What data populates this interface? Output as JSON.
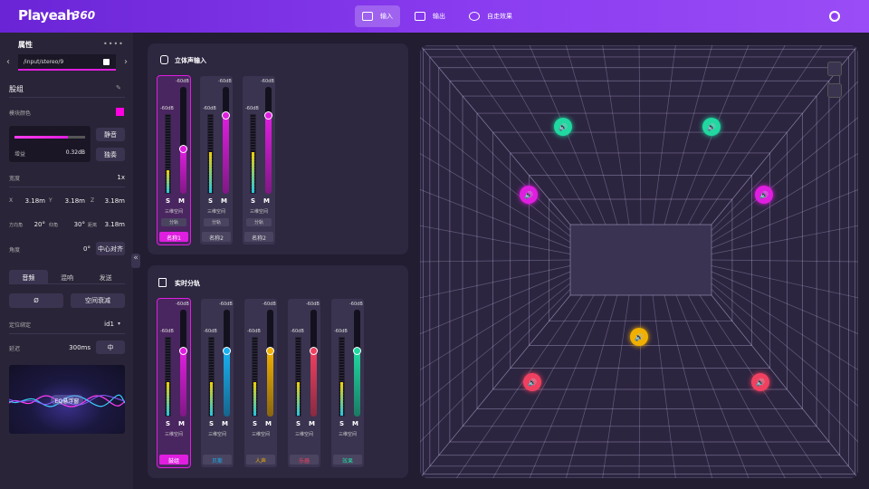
{
  "app": {
    "logo": "Playeah",
    "logo_suffix": "360"
  },
  "nav": [
    {
      "label": "输入",
      "active": true
    },
    {
      "label": "输出",
      "active": false
    },
    {
      "label": "自走效果",
      "active": false
    }
  ],
  "sidebar": {
    "title": "属性",
    "path": "/input/stereo/9",
    "group": "股组",
    "color_label": "模块颜色",
    "accent": "#ff00e0",
    "gain_label": "增益",
    "gain_value": "0.32dB",
    "gain_level": 0.75,
    "mute": "静音",
    "solo": "独奏",
    "width_label": "宽度",
    "width_value": "1x",
    "x_label": "X",
    "x_value": "3.18m",
    "y_label": "Y",
    "y_value": "3.18m",
    "z_label": "Z",
    "z_value": "3.18m",
    "azimuth_label": "方向角",
    "azimuth_value": "20°",
    "elevation_label": "仰角",
    "elevation_value": "30°",
    "distance_label": "距离",
    "distance_value": "3.18m",
    "angle_label": "角度",
    "angle_value": "0°",
    "center_btn": "中心对齐",
    "tabs": [
      "音频",
      "混响",
      "发送"
    ],
    "phase_btn": "Ø",
    "spatial_btn": "空间衰减",
    "pos_label": "定位绑定",
    "pos_value": "id1",
    "delay_label": "延迟",
    "delay_value": "300ms",
    "delay_btn": "中",
    "eq_label": "EQ悬浮窗"
  },
  "stereo": {
    "title": "立体声输入",
    "strips": [
      {
        "name": "名称1",
        "top_db": "-60dB",
        "meter_db": "-60dB",
        "s": "S",
        "m": "M",
        "mode": "三维空间",
        "tag": "分轨",
        "level": 0.42,
        "color": "#e01ee0",
        "selected": true
      },
      {
        "name": "名称2",
        "top_db": "-60dB",
        "meter_db": "-60dB",
        "s": "S",
        "m": "M",
        "mode": "三维空间",
        "tag": "分轨",
        "level": 0.74,
        "color": "#e01ee0",
        "selected": false
      },
      {
        "name": "名称2",
        "top_db": "-60dB",
        "meter_db": "-60dB",
        "s": "S",
        "m": "M",
        "mode": "三维空间",
        "tag": "分轨",
        "level": 0.74,
        "color": "#e01ee0",
        "selected": false
      }
    ]
  },
  "realtime": {
    "title": "实时分轨",
    "strips": [
      {
        "name": "鼓组",
        "top_db": "-60dB",
        "meter_db": "-60dB",
        "s": "S",
        "m": "M",
        "mode": "三维空间",
        "level": 0.62,
        "color": "#e01ee0",
        "label_color": "#ff3cf0",
        "selected": true
      },
      {
        "name": "贝斯",
        "top_db": "-60dB",
        "meter_db": "-60dB",
        "s": "S",
        "m": "M",
        "mode": "三维空间",
        "level": 0.62,
        "color": "#18b0f0",
        "label_color": "#18b0f0",
        "selected": false
      },
      {
        "name": "人声",
        "top_db": "-60dB",
        "meter_db": "-60dB",
        "s": "S",
        "m": "M",
        "mode": "三维空间",
        "level": 0.62,
        "color": "#f0b000",
        "label_color": "#f0b000",
        "selected": false
      },
      {
        "name": "乐器",
        "top_db": "-60dB",
        "meter_db": "-60dB",
        "s": "S",
        "m": "M",
        "mode": "三维空间",
        "level": 0.62,
        "color": "#f04060",
        "label_color": "#f04060",
        "selected": false
      },
      {
        "name": "效果",
        "top_db": "-60dB",
        "meter_db": "-60dB",
        "s": "S",
        "m": "M",
        "mode": "三维空间",
        "level": 0.62,
        "color": "#20d8a0",
        "label_color": "#20d8a0",
        "selected": false
      }
    ]
  },
  "view": {
    "speakers": [
      {
        "id": "fl-top",
        "color": "#20d8a0"
      },
      {
        "id": "fr-top",
        "color": "#20d8a0"
      },
      {
        "id": "l-mid",
        "color": "#e01ee0"
      },
      {
        "id": "r-mid",
        "color": "#e01ee0"
      },
      {
        "id": "center",
        "color": "#f0b000"
      },
      {
        "id": "bl",
        "color": "#f04060"
      },
      {
        "id": "br",
        "color": "#f04060"
      }
    ]
  }
}
